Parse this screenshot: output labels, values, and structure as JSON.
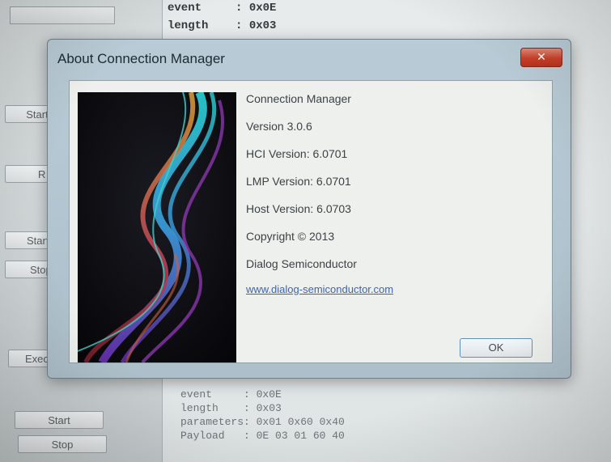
{
  "background": {
    "buttons": [
      {
        "label": "Start"
      },
      {
        "label": "R"
      },
      {
        "label": "Start"
      },
      {
        "label": "Stop"
      },
      {
        "label": "Execut"
      },
      {
        "label": "Start"
      },
      {
        "label": "Stop"
      }
    ],
    "console_top": [
      "event     : 0x0E",
      "length    : 0x03"
    ],
    "console_bottom": [
      "event     : 0x0E",
      "length    : 0x03",
      "parameters: 0x01 0x60 0x40",
      "Payload   : 0E 03 01 60 40"
    ]
  },
  "dialog": {
    "title": "About Connection Manager",
    "close_glyph": "✕",
    "product_name": "Connection Manager",
    "version": "Version 3.0.6",
    "hci_version": "HCI Version: 6.0701",
    "lmp_version": "LMP Version: 6.0701",
    "host_version": "Host Version: 6.0703",
    "copyright": "Copyright © 2013",
    "company": "Dialog Semiconductor",
    "website": "www.dialog-semiconductor.com",
    "ok_label": "OK",
    "colors": {
      "title_bar": "#b9cbd6",
      "close_button": "#c8412a",
      "link": "#3f62b0"
    }
  }
}
